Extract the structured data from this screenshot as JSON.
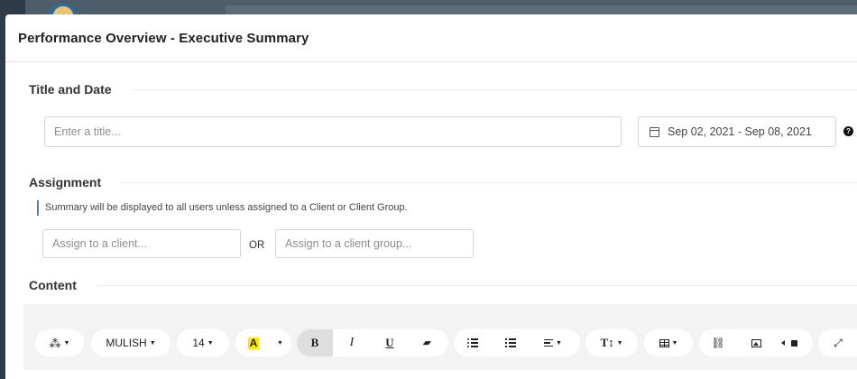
{
  "modal": {
    "title": "Performance Overview - Executive Summary"
  },
  "title_section": {
    "heading": "Title and Date",
    "title_placeholder": "Enter a title...",
    "date_range": "Sep 02, 2021 - Sep 08, 2021",
    "help_glyph": "?"
  },
  "assignment_section": {
    "heading": "Assignment",
    "note": "Summary will be displayed to all users unless assigned to a Client or Client Group.",
    "client_placeholder": "Assign to a client...",
    "or_label": "OR",
    "group_placeholder": "Assign to a client group..."
  },
  "content_section": {
    "heading": "Content"
  },
  "toolbar": {
    "style_icon": "magic-wand-icon",
    "font_name": "MULISH",
    "font_size": "14",
    "highlight_letter": "A",
    "highlight_color": "#ffe600",
    "bold": "B",
    "italic": "I",
    "underline": "U",
    "clear_format_icon": "eraser-icon",
    "unordered_list_icon": "bullet-list-icon",
    "ordered_list_icon": "numbered-list-icon",
    "align_icon": "align-left-icon",
    "text_height_label": "T↕",
    "table_icon": "table-icon",
    "link_icon": "link-icon",
    "picture_icon": "image-icon",
    "video_icon": "video-icon",
    "fullscreen_icon": "expand-icon"
  },
  "colors": {
    "backdrop": "#3f4d5a",
    "accent_rule": "#5b7db1",
    "toolbar_bg": "#f3f3f3"
  }
}
